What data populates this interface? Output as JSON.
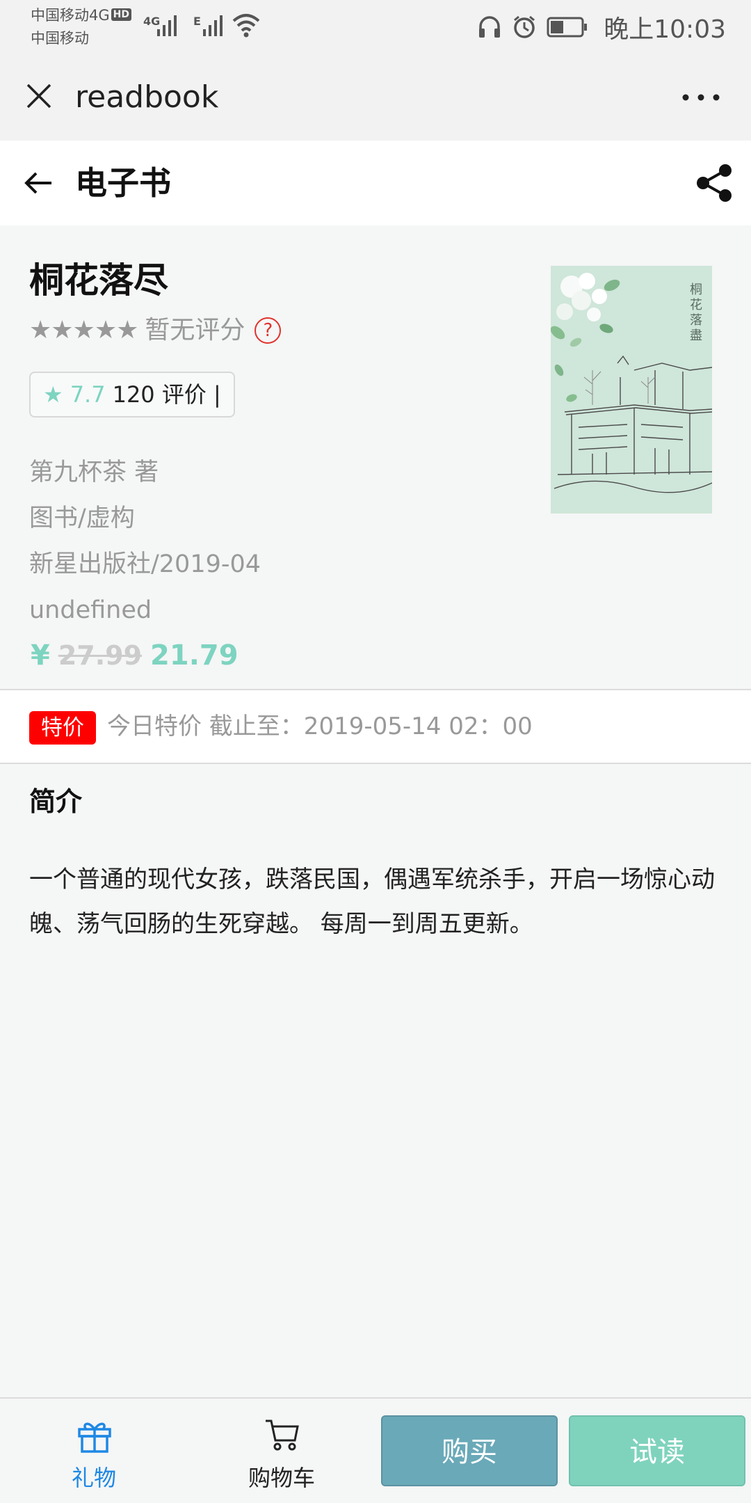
{
  "status_bar": {
    "carrier_1": "中国移动4G",
    "hd_badge": "HD",
    "carrier_2": "中国移动",
    "signal_1_label": "4G",
    "signal_2_label": "E",
    "time": "晚上10:03"
  },
  "webview": {
    "title": "readbook"
  },
  "header": {
    "title": "电子书"
  },
  "book": {
    "title": "桐花落尽",
    "rating_stars": "★★★★★",
    "rating_text": "暂无评分",
    "help_glyph": "?",
    "score_star": "★",
    "score": "7.7",
    "review_count": "120 评价 |",
    "author": "第九杯茶 著",
    "category": "图书/虚构",
    "publisher": "新星出版社/2019-04",
    "extra": "undefined",
    "currency": "¥",
    "original_price": "27.99",
    "sale_price": "21.79",
    "cover_title": "桐花落盡"
  },
  "promo": {
    "badge": "特价",
    "text": "今日特价 截止至：2019-05-14 02：00"
  },
  "summary": {
    "heading": "简介",
    "body": "一个普通的现代女孩，跌落民国，偶遇军统杀手，开启一场惊心动魄、荡气回肠的生死穿越。 每周一到周五更新。"
  },
  "bottom_bar": {
    "gift_label": "礼物",
    "cart_label": "购物车",
    "buy_label": "购买",
    "try_label": "试读"
  },
  "colors": {
    "accent_teal": "#7dd4c0",
    "buy_button": "#6aa9b8",
    "promo_red": "#ff0000",
    "gift_blue": "#1e88e5"
  }
}
